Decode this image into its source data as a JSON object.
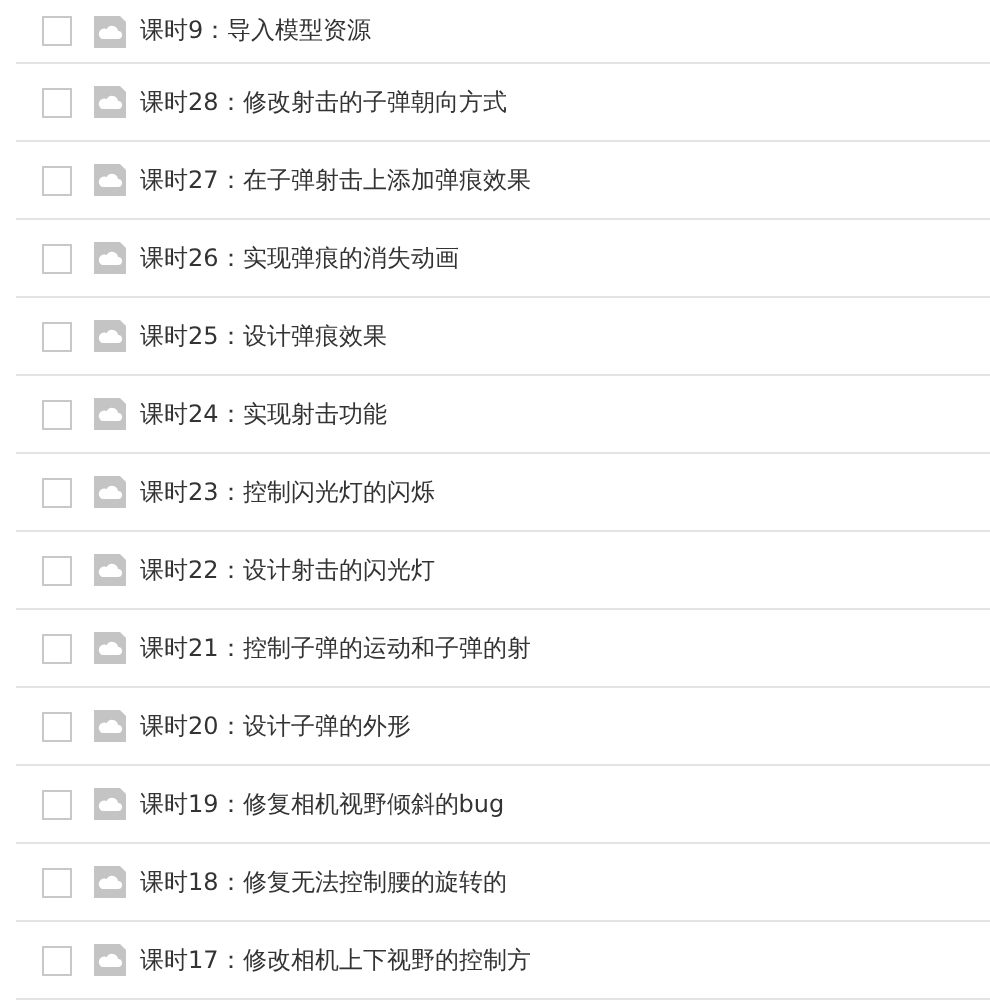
{
  "lessons": [
    {
      "title": "课时9：导入模型资源",
      "checked": false
    },
    {
      "title": "课时28：修改射击的子弹朝向方式",
      "checked": false
    },
    {
      "title": "课时27：在子弹射击上添加弹痕效果",
      "checked": false
    },
    {
      "title": "课时26：实现弹痕的消失动画",
      "checked": false
    },
    {
      "title": "课时25：设计弹痕效果",
      "checked": false
    },
    {
      "title": "课时24：实现射击功能",
      "checked": false
    },
    {
      "title": "课时23：控制闪光灯的闪烁",
      "checked": false
    },
    {
      "title": "课时22：设计射击的闪光灯",
      "checked": false
    },
    {
      "title": "课时21：控制子弹的运动和子弹的射",
      "checked": false
    },
    {
      "title": "课时20：设计子弹的外形",
      "checked": false
    },
    {
      "title": "课时19：修复相机视野倾斜的bug",
      "checked": false
    },
    {
      "title": "课时18：修复无法控制腰的旋转的",
      "checked": false
    },
    {
      "title": "课时17：修改相机上下视野的控制方",
      "checked": false
    }
  ]
}
